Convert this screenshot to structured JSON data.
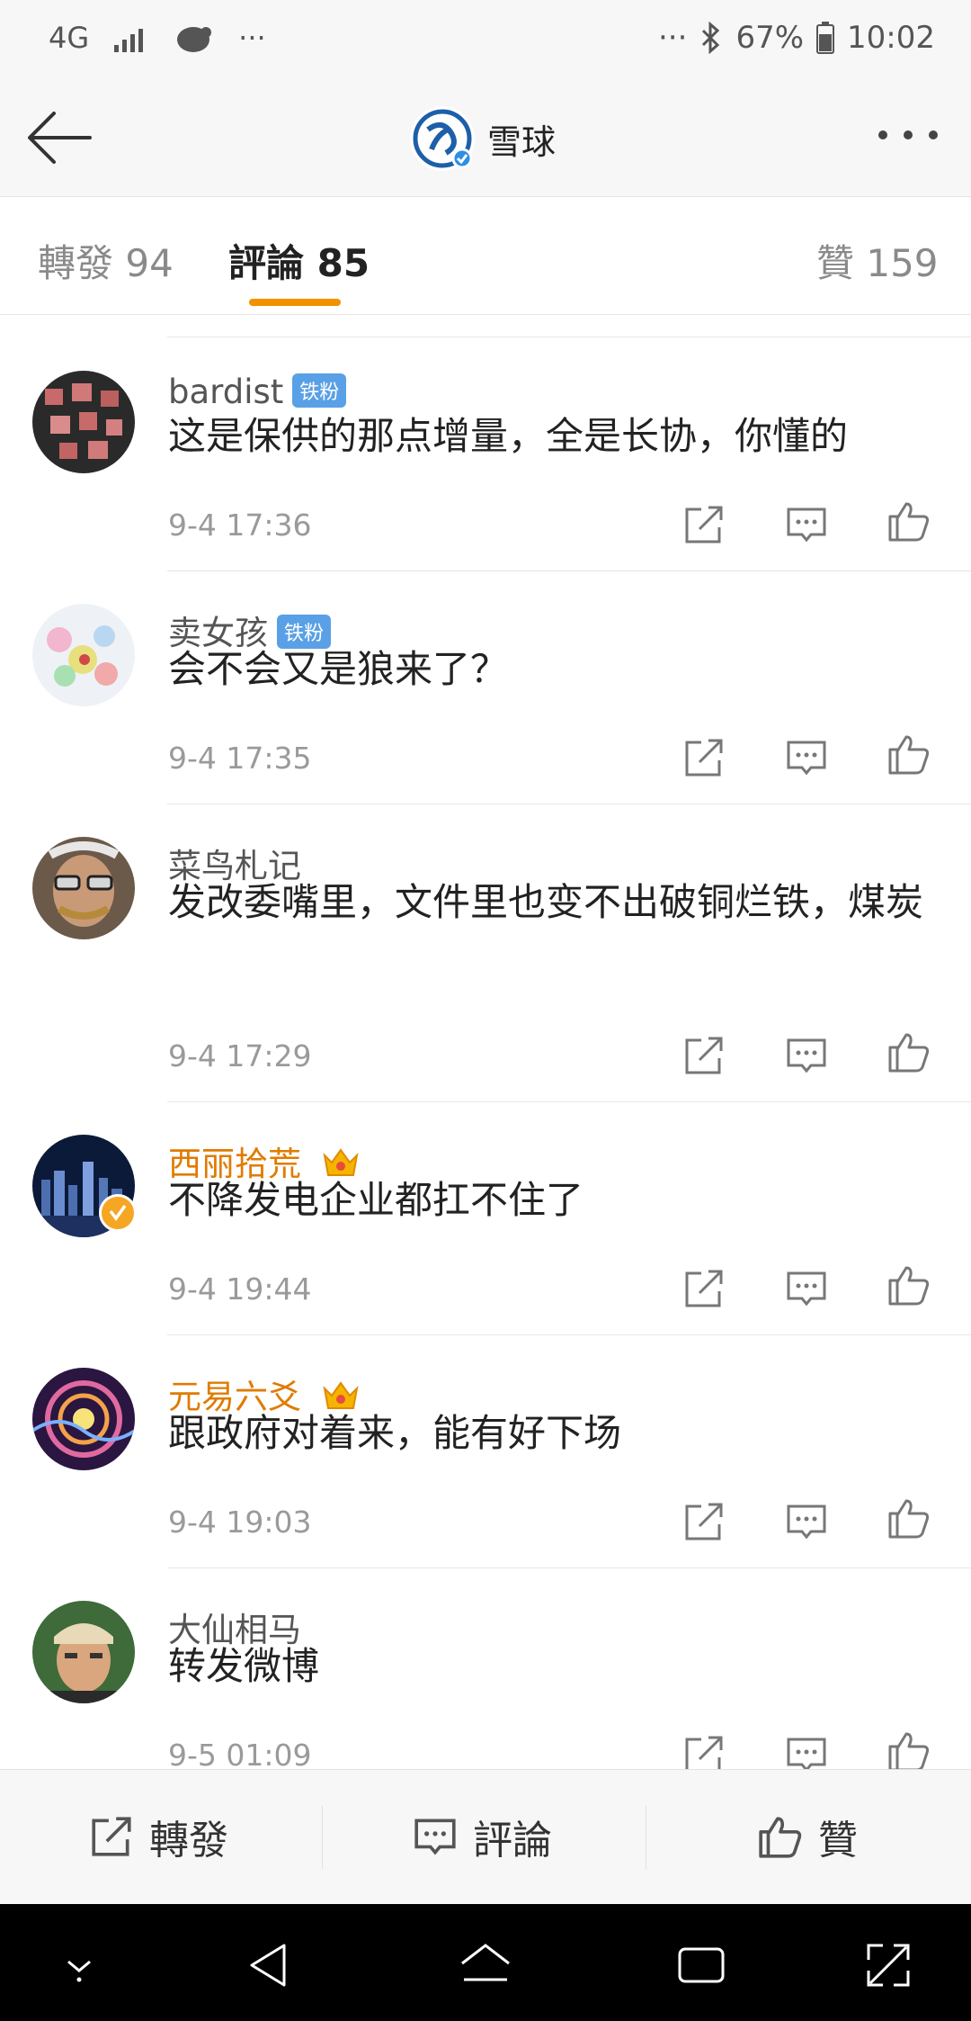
{
  "status_bar": {
    "network": "4G",
    "dots_left": "···",
    "dots_right": "···",
    "battery": "67%",
    "time": "10:02"
  },
  "header": {
    "title": "雪球"
  },
  "tabs": [
    {
      "label": "轉發 94"
    },
    {
      "label": "評論 85"
    },
    {
      "label": "贊 159"
    }
  ],
  "comments": [
    {
      "user": "bardist",
      "badge": "铁粉",
      "text": "这是保供的那点增量，全是长协，你懂的",
      "time": "9-4 17:36"
    },
    {
      "user": "卖女孩",
      "badge": "铁粉",
      "text": "会不会又是狼来了？",
      "time": "9-4 17:35"
    },
    {
      "user": "菜鸟札记",
      "badge": "",
      "text": "发改委嘴里，文件里也变不出破铜烂铁，煤炭",
      "time": "9-4 17:29"
    },
    {
      "user": "西丽拾荒",
      "badge": "",
      "text": "不降发电企业都扛不住了",
      "time": "9-4 19:44"
    },
    {
      "user": "元易六爻",
      "badge": "",
      "text": "跟政府对着来，能有好下场",
      "time": "9-4 19:03"
    },
    {
      "user": "大仙相马",
      "badge": "",
      "text": "转发微博",
      "time": "9-5 01:09"
    }
  ],
  "bottom_bar": {
    "repost": "轉發",
    "comment": "評論",
    "like": "贊"
  },
  "colors": {
    "accent": "#f29100",
    "vip_name": "#e07b00",
    "fan_badge": "#5aa0e6"
  }
}
